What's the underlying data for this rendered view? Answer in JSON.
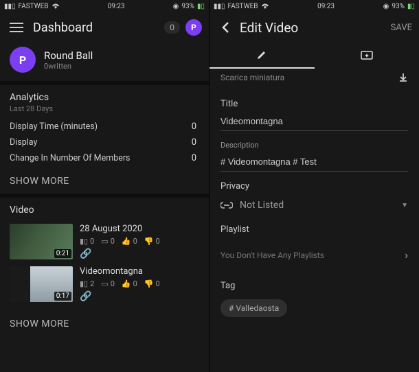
{
  "left": {
    "status": {
      "carrier": "FASTWEB",
      "time": "09:23",
      "battery": "93%"
    },
    "header": {
      "title": "Dashboard",
      "badge": "0",
      "avatar_letter": "P"
    },
    "channel": {
      "name": "Round Ball",
      "sub": "0written",
      "avatar_letter": "P"
    },
    "analytics": {
      "title": "Analytics",
      "subtitle": "Last 28 Days",
      "rows": [
        {
          "label": "Display Time (minutes)",
          "value": "0"
        },
        {
          "label": "Display",
          "value": "0"
        },
        {
          "label": "Change In Number Of Members",
          "value": "0"
        }
      ],
      "show_more": "SHOW MORE"
    },
    "videos": {
      "title": "Video",
      "items": [
        {
          "title": "28 August 2020",
          "duration": "0:21",
          "views": "0",
          "comments": "0",
          "likes": "0",
          "dislikes": "0"
        },
        {
          "title": "Videomontagna",
          "duration": "0:17",
          "views": "2",
          "comments": "0",
          "likes": "0",
          "dislikes": "0"
        }
      ],
      "show_more": "SHOW MORE"
    }
  },
  "right": {
    "status": {
      "carrier": "FASTWEB",
      "time": "09:23",
      "battery": "93%"
    },
    "header": {
      "title": "Edit Video",
      "save": "SAVE"
    },
    "download_thumb": "Scarica miniatura",
    "title_label": "Title",
    "title_value": "Videomontagna",
    "desc_label": "Description",
    "desc_value": "# Videomontagna # Test",
    "privacy_label": "Privacy",
    "privacy_value": "Not Listed",
    "playlist_label": "Playlist",
    "playlist_empty": "You Don't Have Any Playlists",
    "tag_label": "Tag",
    "tag_chip": "# Valledaosta"
  }
}
